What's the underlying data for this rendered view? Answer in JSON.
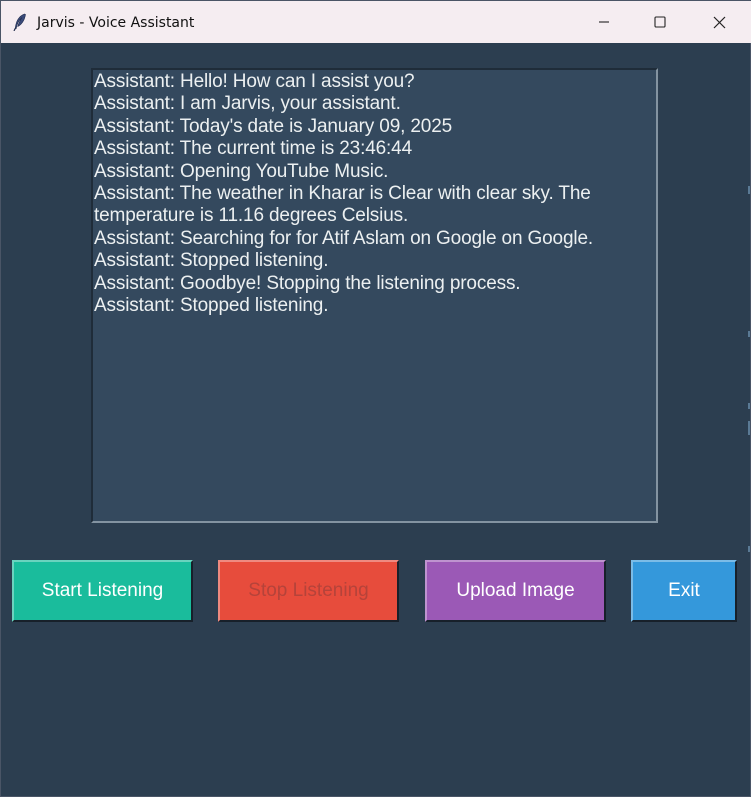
{
  "window": {
    "title": "Jarvis - Voice Assistant",
    "app_icon": "feather-icon",
    "controls": {
      "minimize_icon": "minimize-icon",
      "maximize_icon": "maximize-icon",
      "close_icon": "close-icon"
    }
  },
  "conversation": {
    "lines": [
      "Assistant: Hello! How can I assist you?",
      "Assistant: I am Jarvis, your assistant.",
      "Assistant: Today's date is January 09, 2025",
      "Assistant: The current time is 23:46:44",
      "Assistant: Opening YouTube Music.",
      "Assistant: The weather in Kharar is Clear with clear sky. The temperature is 11.16 degrees Celsius.",
      "Assistant: Searching for for Atif Aslam on Google on Google.",
      "Assistant: Stopped listening.",
      "Assistant: Goodbye! Stopping the listening process.",
      "Assistant: Stopped listening."
    ]
  },
  "buttons": {
    "start": {
      "label": "Start Listening",
      "color": "#1abc9c"
    },
    "stop": {
      "label": "Stop Listening",
      "color": "#e74c3c",
      "state": "disabled"
    },
    "upload": {
      "label": "Upload Image",
      "color": "#9b59b6"
    },
    "exit": {
      "label": "Exit",
      "color": "#3498db"
    }
  },
  "colors": {
    "window_background": "#2c3e50",
    "text_area_background": "#34495e",
    "text_color": "#ecf0f1",
    "titlebar_background": "#f5edf1"
  }
}
